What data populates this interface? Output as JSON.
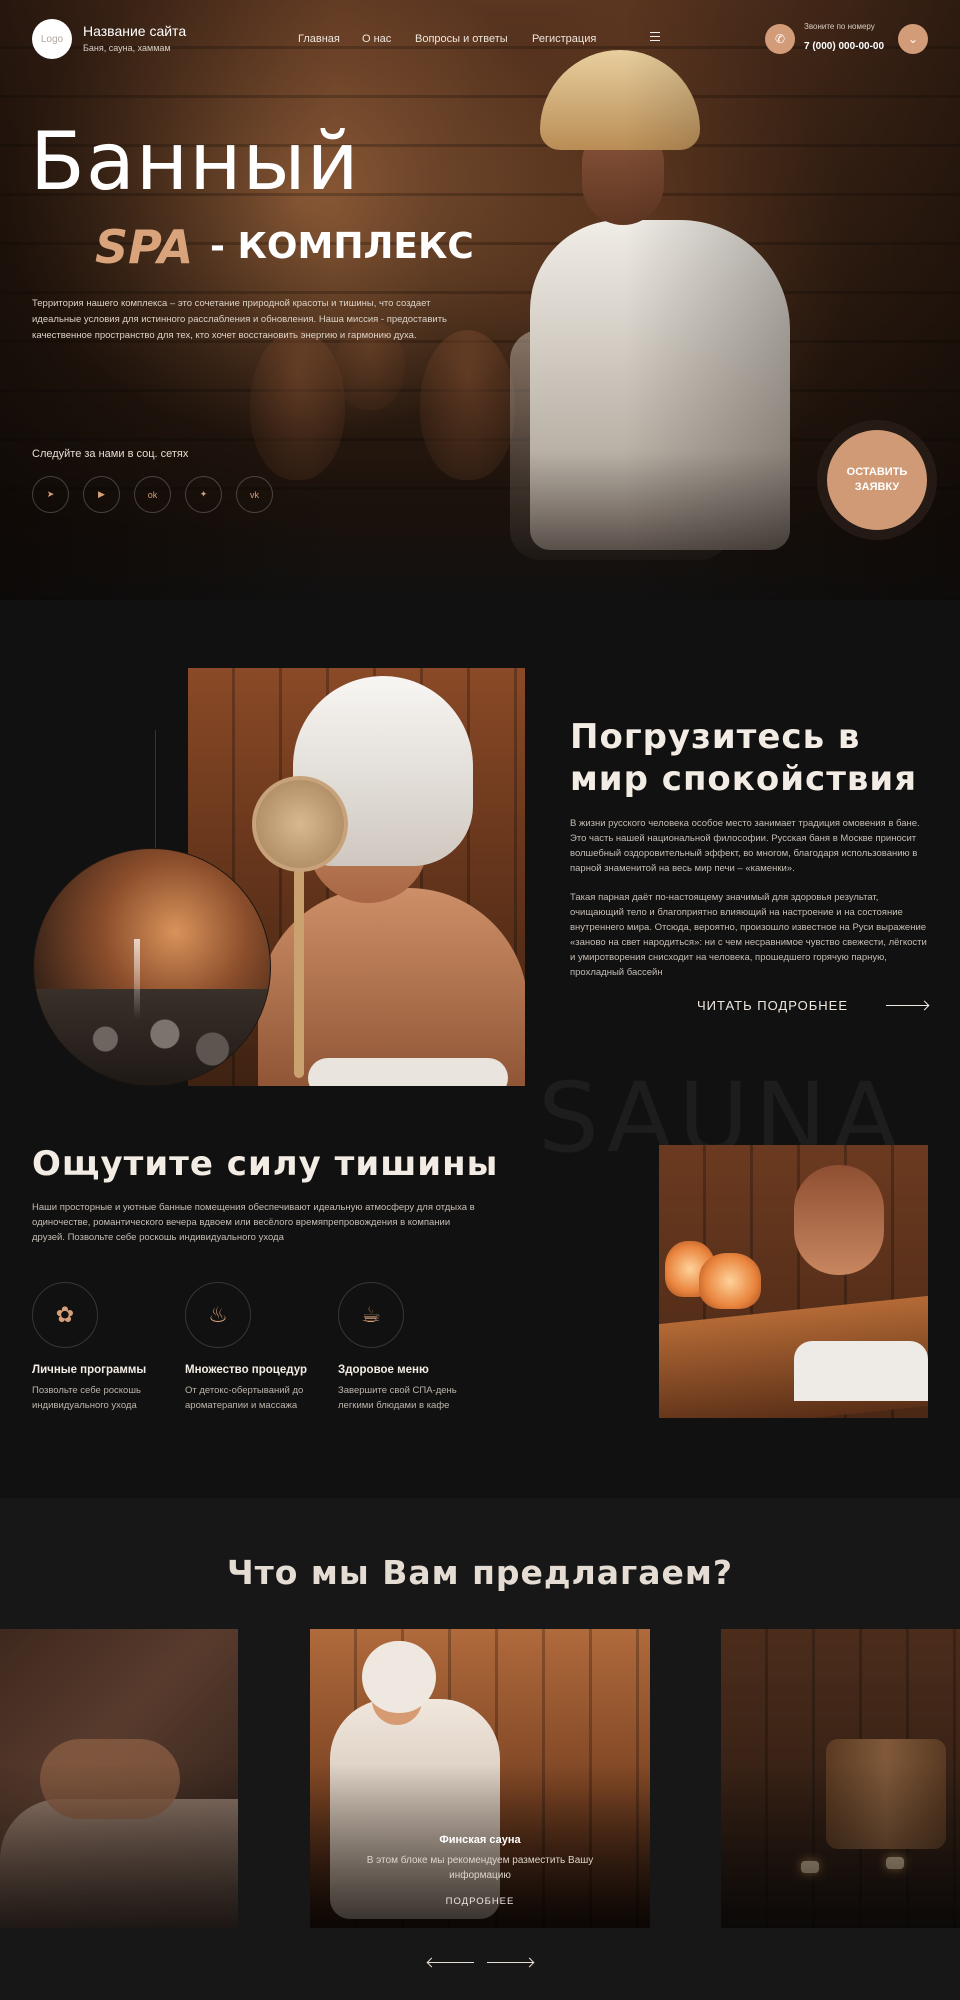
{
  "header": {
    "logo_text": "Logo",
    "site_title": "Название сайта",
    "site_subtitle": "Баня, сауна, хаммам",
    "nav": [
      "Главная",
      "О нас",
      "Вопросы и ответы",
      "Регистрация"
    ],
    "phone_caption": "Звоните по номеру",
    "phone_number": "7 (000) 000-00-00",
    "icons": {
      "menu": "burger-menu-icon",
      "phone": "phone-icon",
      "dropdown": "chevron-down-icon"
    }
  },
  "hero": {
    "title_line1": "Банный",
    "title_spa": "SPA",
    "title_rest": "- КОМПЛЕКС",
    "description": "Территория нашего комплекса – это сочетание природной красоты и тишины, что создает идеальные условия для истинного расслабления и обновления. Наша миссия - предоставить качественное пространство для тех, кто хочет восстановить энергию и гармонию духа.",
    "follow_label": "Следуйте за нами в соц. сетях",
    "socials": [
      {
        "name": "telegram",
        "glyph": "➤"
      },
      {
        "name": "youtube",
        "glyph": "▶"
      },
      {
        "name": "odnoklassniki",
        "glyph": "ok"
      },
      {
        "name": "twitter",
        "glyph": "✦"
      },
      {
        "name": "vk",
        "glyph": "vk"
      }
    ],
    "cta_label": "ОСТАВИТЬ ЗАЯВКУ"
  },
  "about": {
    "title": "Погрузитесь в мир спокойствия",
    "paragraph1": "В жизни русского человека особое место занимает традиция омовения в бане. Это часть нашей национальной философии. Русская баня в Москве приносит волшебный оздоровительный эффект, во многом, благодаря использованию в парной знаменитой на весь мир печи – «каменки».",
    "paragraph2": "Такая парная даёт по-настоящему значимый для здоровья результат, очищающий тело и благоприятно влияющий на настроение и на состояние внутреннего мира. Отсюда, вероятно, произошло известное на Руси выражение «заново на свет народиться»: ни с чем несравнимое чувство свежести, лёгкости и умиротворения снисходит на человека, прошедшего горячую парную, прохладный бассейн",
    "read_more": "ЧИТАТЬ ПОДРОБНЕЕ"
  },
  "silence": {
    "watermark": "SAUNA",
    "title": "Ощутите силу тишины",
    "description": "Наши просторные и уютные банные помещения обеспечивают идеальную атмосферу для отдыха в одиночестве, романтического вечера вдвоем или весёлого времяпрепровождения в компании друзей. Позвольте себе роскошь индивидуального ухода",
    "features": [
      {
        "title": "Личные программы",
        "desc": "Позвольте себе роскошь индивидуального ухода",
        "icon": "spa-kit-icon",
        "glyph": "✿"
      },
      {
        "title": "Множество процедур",
        "desc": "От детокс-обертываний до ароматерапии и массажа",
        "icon": "candles-icon",
        "glyph": "♨"
      },
      {
        "title": "Здоровое меню",
        "desc": "Завершите свой СПА-день легкими блюдами в кафе",
        "icon": "serving-dish-icon",
        "glyph": "☕"
      }
    ]
  },
  "offer": {
    "title": "Что мы Вам предлагаем?",
    "active_card": {
      "name": "Финская сауна",
      "text": "В этом блоке мы рекомендуем разместить Вашу информацию",
      "link": "ПОДРОБНЕЕ"
    }
  }
}
